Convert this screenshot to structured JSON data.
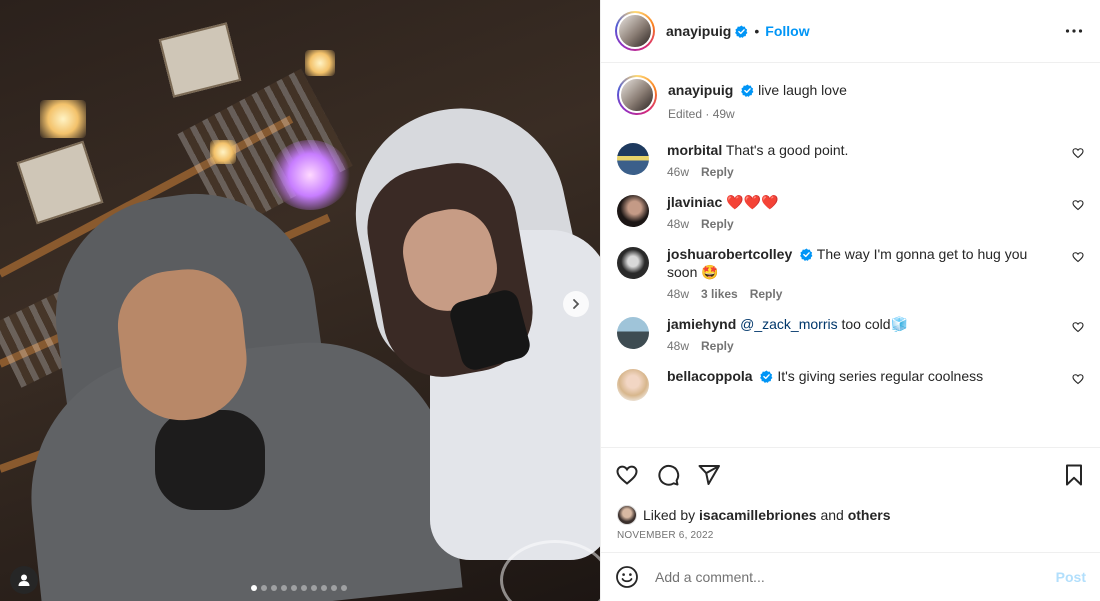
{
  "post": {
    "carousel": {
      "slide_count": 10,
      "active_index": 0
    }
  },
  "header": {
    "username": "anayipuig",
    "separator": "•",
    "follow_label": "Follow"
  },
  "caption": {
    "username": "anayipuig",
    "text": "live laugh love",
    "meta": "Edited · 49w"
  },
  "comments": [
    {
      "username": "morbital",
      "text": "That's a good point.",
      "time": "46w",
      "likes": "",
      "reply": "Reply",
      "verified": false
    },
    {
      "username": "jlaviniac",
      "text": "❤️❤️❤️",
      "time": "48w",
      "likes": "",
      "reply": "Reply",
      "verified": false
    },
    {
      "username": "joshuarobertcolley",
      "text": "The way I'm gonna get to hug you soon 🤩",
      "time": "48w",
      "likes": "3 likes",
      "reply": "Reply",
      "verified": true
    },
    {
      "username": "jamiehynd",
      "mention": "@_zack_morris",
      "text": " too cold🧊",
      "time": "48w",
      "likes": "",
      "reply": "Reply",
      "verified": false
    },
    {
      "username": "bellacoppola",
      "text": "It's giving series regular coolness",
      "time": "",
      "likes": "",
      "reply": "",
      "verified": true
    }
  ],
  "likes": {
    "prefix": "Liked by",
    "user": "isacamillebriones",
    "and": "and",
    "others": "others"
  },
  "date": "NOVEMBER 6, 2022",
  "add_comment": {
    "placeholder": "Add a comment...",
    "post_label": "Post"
  },
  "colors": {
    "accent": "#0095f6",
    "verified": "#0095f6",
    "post_disabled": "#b2dffc"
  }
}
